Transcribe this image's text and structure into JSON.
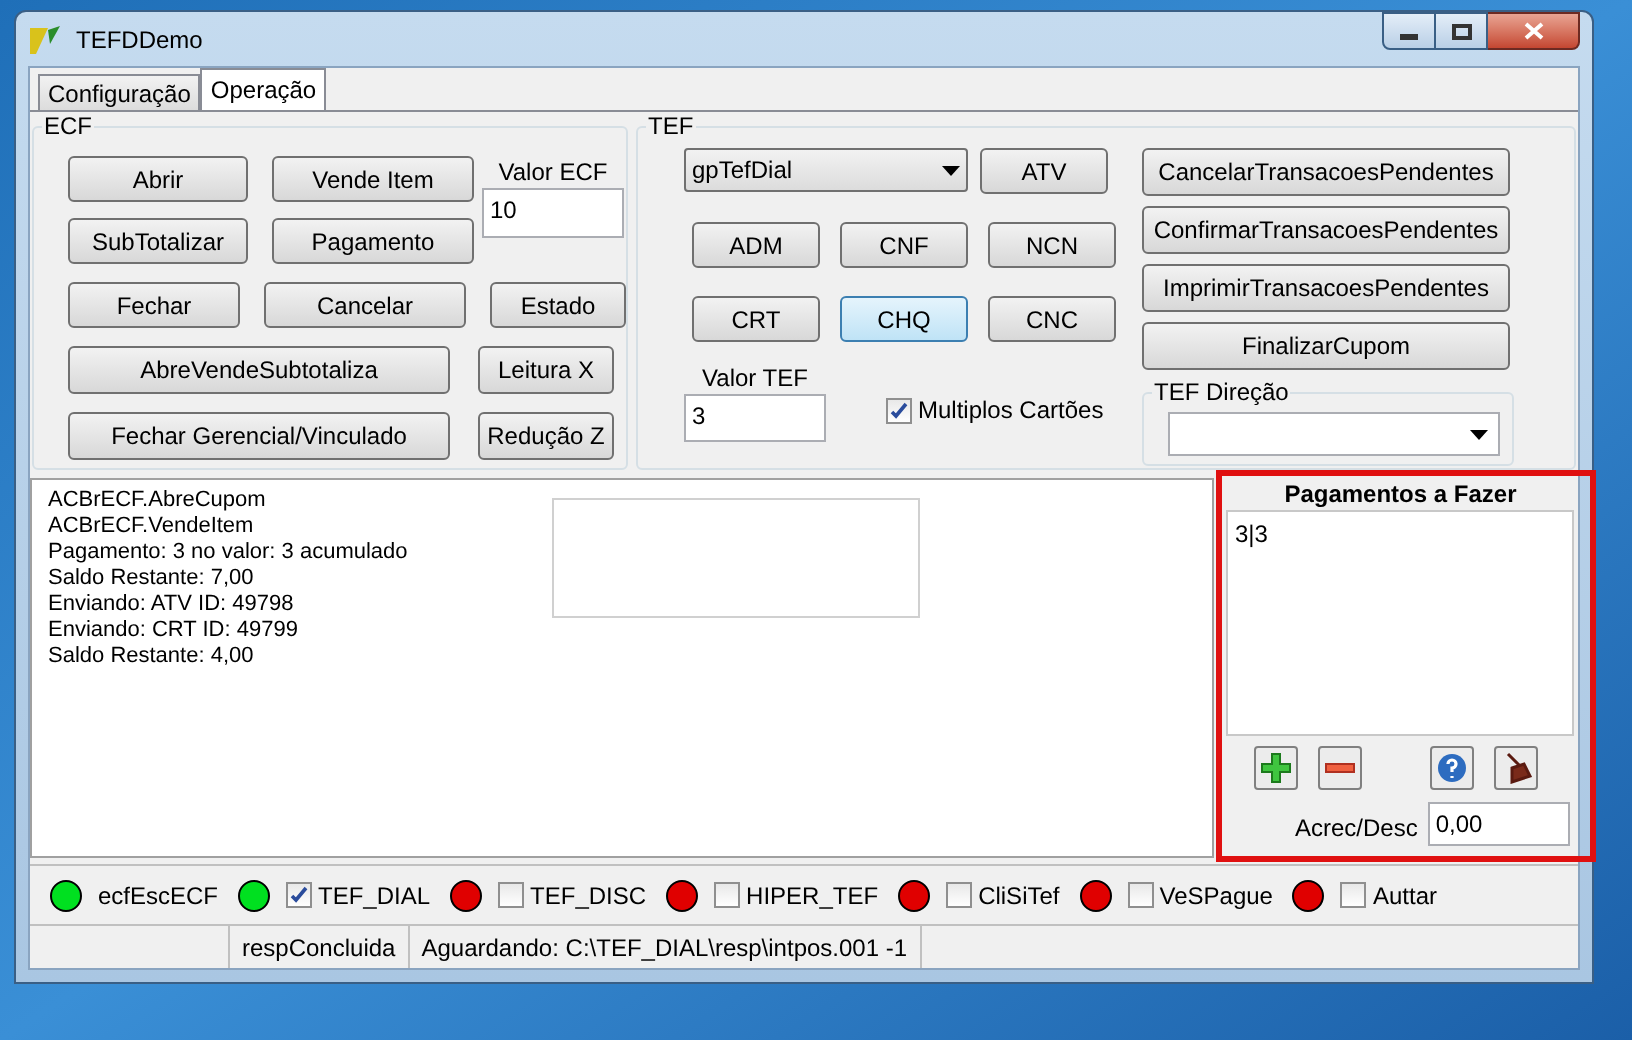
{
  "window": {
    "title": "TEFDDemo"
  },
  "tabs": [
    {
      "label": "Configuração",
      "selected": false
    },
    {
      "label": "Operação",
      "selected": true
    }
  ],
  "ecf": {
    "title": "ECF",
    "buttons": [
      "Abrir",
      "Vende Item",
      "SubTotalizar",
      "Pagamento",
      "Fechar",
      "Cancelar",
      "Estado",
      "AbreVendeSubtotaliza",
      "Leitura X",
      "Fechar Gerencial/Vinculado",
      "Redução Z"
    ],
    "valor_label": "Valor ECF",
    "valor_value": "10"
  },
  "tef": {
    "title": "TEF",
    "gateway": "gpTefDial",
    "atv": "ATV",
    "buttons": [
      {
        "label": "ADM",
        "focused": false
      },
      {
        "label": "CNF",
        "focused": false
      },
      {
        "label": "NCN",
        "focused": false
      },
      {
        "label": "CRT",
        "focused": false
      },
      {
        "label": "CHQ",
        "focused": true
      },
      {
        "label": "CNC",
        "focused": false
      }
    ],
    "actions": [
      "CancelarTransacoesPendentes",
      "ConfirmarTransacoesPendentes",
      "ImprimirTransacoesPendentes",
      "FinalizarCupom"
    ],
    "valor_label": "Valor TEF",
    "valor_value": "3",
    "multiplos": {
      "label": "Multiplos Cartões",
      "checked": true
    },
    "direcao_title": "TEF Direção"
  },
  "log": {
    "lines": [
      "ACBrECF.AbreCupom",
      "ACBrECF.VendeItem",
      "Pagamento: 3 no valor: 3 acumulado",
      "Saldo Restante: 7,00",
      "Enviando: ATV ID: 49798",
      "Enviando: CRT ID: 49799",
      "Saldo Restante: 4,00"
    ]
  },
  "pagamentos": {
    "title": "Pagamentos a Fazer",
    "items": [
      "3|3"
    ],
    "acrec_label": "Acrec/Desc",
    "acrec_value": "0,00"
  },
  "indicators": [
    {
      "kind": "label",
      "label": "ecfEscECF",
      "color": "#00e020"
    },
    {
      "kind": "checkbox",
      "label": "TEF_DIAL",
      "color": "#00e020",
      "checked": true
    },
    {
      "kind": "checkbox",
      "label": "TEF_DISC",
      "color": "#e00000",
      "checked": false
    },
    {
      "kind": "checkbox",
      "label": "HIPER_TEF",
      "color": "#e00000",
      "checked": false
    },
    {
      "kind": "checkbox",
      "label": "CliSiTef",
      "color": "#e00000",
      "checked": false
    },
    {
      "kind": "checkbox",
      "label": "VeSPague",
      "color": "#e00000",
      "checked": false
    },
    {
      "kind": "checkbox",
      "label": "Auttar",
      "color": "#e00000",
      "checked": false
    }
  ],
  "status_bar": [
    "respConcluida",
    "Aguardando: C:\\TEF_DIAL\\resp\\intpos.001 -1"
  ]
}
